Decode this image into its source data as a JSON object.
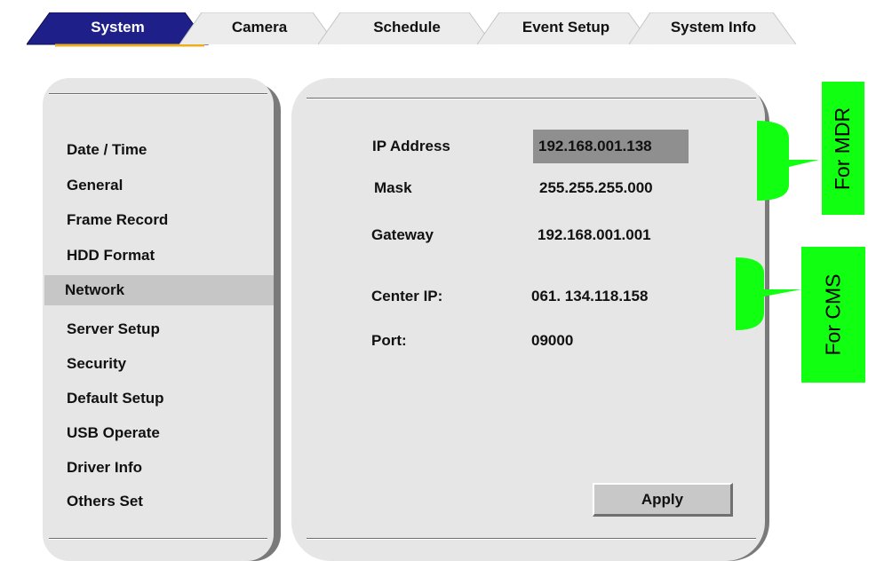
{
  "tabs": [
    {
      "label": "System",
      "active": true
    },
    {
      "label": "Camera",
      "active": false
    },
    {
      "label": "Schedule",
      "active": false
    },
    {
      "label": "Event Setup",
      "active": false
    },
    {
      "label": "System Info",
      "active": false
    }
  ],
  "sidebar": {
    "items": [
      {
        "label": "Date / Time"
      },
      {
        "label": "General"
      },
      {
        "label": "Frame Record"
      },
      {
        "label": "HDD Format"
      },
      {
        "label": "Network",
        "selected": true
      },
      {
        "label": "Server Setup"
      },
      {
        "label": "Security"
      },
      {
        "label": "Default Setup"
      },
      {
        "label": "USB Operate"
      },
      {
        "label": "Driver Info"
      },
      {
        "label": "Others Set"
      }
    ]
  },
  "network": {
    "ip_address_label": "IP Address",
    "ip_address_value": "192.168.001.138",
    "mask_label": "Mask",
    "mask_value": "255.255.255.000",
    "gateway_label": "Gateway",
    "gateway_value": "192.168.001.001",
    "center_ip_label": "Center IP:",
    "center_ip_value": "061. 134.118.158",
    "port_label": "Port:",
    "port_value": "09000",
    "apply_label": "Apply"
  },
  "annotations": {
    "mdr_label": "For MDR",
    "cms_label": "For CMS"
  },
  "colors": {
    "active_tab": "#1f1f8a",
    "active_tab_accent": "#e8b020",
    "inactive_tab": "#ececec",
    "panel": "#e6e6e6",
    "selected_row": "#c6c6c6",
    "annotation": "#11ff11"
  }
}
